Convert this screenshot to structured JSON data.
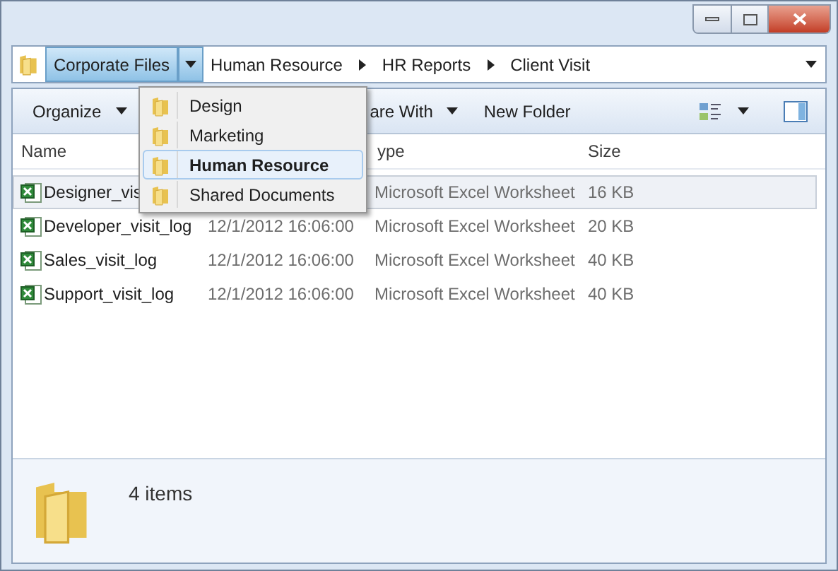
{
  "address_bar": {
    "crumbs": [
      {
        "label": "Corporate Files",
        "selected": true
      },
      {
        "label": "Human Resource",
        "selected": false
      },
      {
        "label": "HR Reports",
        "selected": false
      },
      {
        "label": "Client Visit",
        "selected": false
      }
    ]
  },
  "breadcrumb_menu": {
    "items": [
      {
        "label": "Design",
        "selected": false
      },
      {
        "label": "Marketing",
        "selected": false
      },
      {
        "label": "Human Resource",
        "selected": true
      },
      {
        "label": "Shared Documents",
        "selected": false
      }
    ]
  },
  "toolbar": {
    "buttons": [
      {
        "label": "Organize",
        "has_menu": true
      },
      {
        "label": "are With",
        "has_menu": true
      },
      {
        "label": "New Folder",
        "has_menu": false
      }
    ]
  },
  "table": {
    "columns": {
      "name": "Name",
      "type": "ype",
      "size": "Size"
    },
    "rows": [
      {
        "name": "Designer_vis",
        "type": "Microsoft Excel Worksheet",
        "size": "16 KB",
        "selected": true
      },
      {
        "name": "Developer_visit_log",
        "date": "12/1/2012 16:06:00",
        "type": "Microsoft Excel Worksheet",
        "size": "20 KB",
        "selected": false
      },
      {
        "name": "Sales_visit_log",
        "date": "12/1/2012 16:06:00",
        "type": "Microsoft Excel Worksheet",
        "size": "40 KB",
        "selected": false
      },
      {
        "name": "Support_visit_log",
        "date": "12/1/2012 16:06:00",
        "type": "Microsoft Excel Worksheet",
        "size": "40 KB",
        "selected": false
      }
    ]
  },
  "status_bar": {
    "count": "4 items"
  }
}
